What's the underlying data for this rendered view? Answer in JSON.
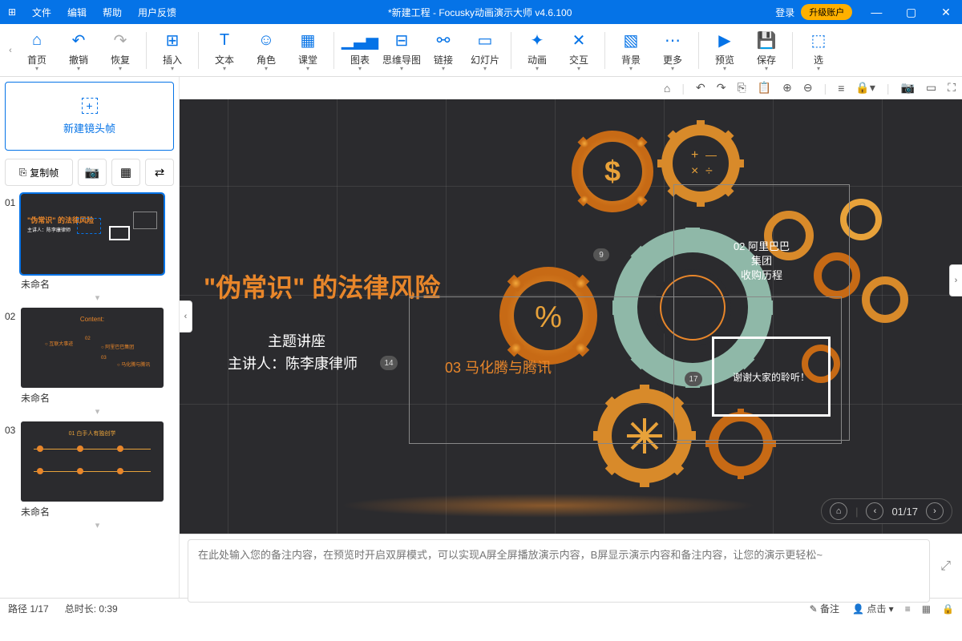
{
  "title_bar": {
    "menus": [
      "文件",
      "编辑",
      "帮助",
      "用户反馈"
    ],
    "title": "*新建工程 - Focusky动画演示大师  v4.6.100",
    "login": "登录",
    "upgrade": "升级账户"
  },
  "toolbar": {
    "items": [
      {
        "label": "首页",
        "icon": "⌂"
      },
      {
        "label": "撤销",
        "icon": "↶"
      },
      {
        "label": "恢复",
        "icon": "↷",
        "disabled": true
      },
      {
        "sep": true
      },
      {
        "label": "插入",
        "icon": "⊞"
      },
      {
        "sep": true
      },
      {
        "label": "文本",
        "icon": "T"
      },
      {
        "label": "角色",
        "icon": "☺"
      },
      {
        "label": "课堂",
        "icon": "▦"
      },
      {
        "sep": true
      },
      {
        "label": "图表",
        "icon": "▁▃▅"
      },
      {
        "label": "思维导图",
        "icon": "⊟"
      },
      {
        "label": "链接",
        "icon": "⚯"
      },
      {
        "label": "幻灯片",
        "icon": "▭"
      },
      {
        "sep": true
      },
      {
        "label": "动画",
        "icon": "✦"
      },
      {
        "label": "交互",
        "icon": "✕"
      },
      {
        "sep": true
      },
      {
        "label": "背景",
        "icon": "▧"
      },
      {
        "label": "更多",
        "icon": "⋯"
      },
      {
        "sep": true
      },
      {
        "label": "预览",
        "icon": "▶"
      },
      {
        "label": "保存",
        "icon": "💾"
      },
      {
        "sep": true
      },
      {
        "label": "选",
        "icon": "⬚"
      }
    ]
  },
  "sidebar": {
    "new_frame": "新建镜头帧",
    "copy_frame": "复制帧",
    "thumbs": [
      {
        "num": "01",
        "label": "未命名"
      },
      {
        "num": "02",
        "label": "未命名"
      },
      {
        "num": "03",
        "label": "未命名"
      }
    ],
    "thumb2_title": "Content:",
    "thumb3_title": "01 白手人有独创学"
  },
  "canvas": {
    "main_title": "\"伪常识\" 的法律风险",
    "subtitle1": "主题讲座",
    "subtitle2": "主讲人：陈李康律师",
    "badge14": "14",
    "badge9": "9",
    "badge17": "17",
    "section03": "03 马化腾与腾讯",
    "section02a": "02 阿里巴巴",
    "section02b": "集团",
    "section02c": "收购历程",
    "thanks": "谢谢大家的聆听！",
    "nav_counter": "01/17"
  },
  "notes": {
    "placeholder": "在此处输入您的备注内容，在预览时开启双屏模式，可以实现A屏全屏播放演示内容，B屏显示演示内容和备注内容，让您的演示更轻松~"
  },
  "status": {
    "path": "路径 1/17",
    "duration": "总时长: 0:39",
    "notes_btn": "备注",
    "click_btn": "点击"
  }
}
